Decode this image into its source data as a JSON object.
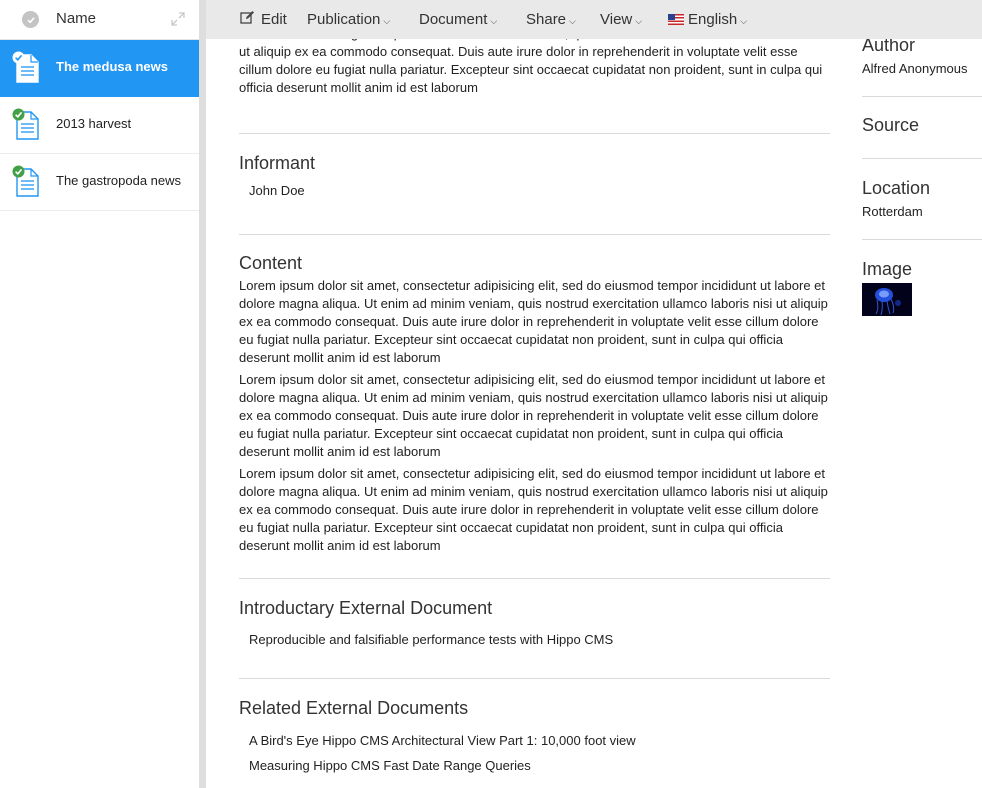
{
  "sidebar": {
    "header_label": "Name",
    "documents": [
      {
        "label": "The medusa news",
        "active": true
      },
      {
        "label": "2013 harvest",
        "active": false
      },
      {
        "label": "The gastropoda news",
        "active": false
      }
    ]
  },
  "toolbar": {
    "edit": "Edit",
    "publication": "Publication",
    "document": "Document",
    "share": "Share",
    "view": "View",
    "language": "English"
  },
  "main": {
    "intro_text": "labore et dolore magna aliqua. Ut enim ad minim veniam, quis nostrud exercitation ullamco laboris nisi ut aliquip ex ea commodo consequat. Duis aute irure dolor in reprehenderit in voluptate velit esse cillum dolore eu fugiat nulla pariatur. Excepteur sint occaecat cupidatat non proident, sunt in culpa qui officia deserunt mollit anim id est laborum",
    "informant": {
      "title": "Informant",
      "value": "John Doe"
    },
    "content": {
      "title": "Content",
      "paragraphs": [
        "Lorem ipsum dolor sit amet, consectetur adipisicing elit, sed do eiusmod tempor incididunt ut labore et dolore magna aliqua. Ut enim ad minim veniam, quis nostrud exercitation ullamco laboris nisi ut aliquip ex ea commodo consequat. Duis aute irure dolor in reprehenderit in voluptate velit esse cillum dolore eu fugiat nulla pariatur. Excepteur sint occaecat cupidatat non proident, sunt in culpa qui officia deserunt mollit anim id est laborum",
        "Lorem ipsum dolor sit amet, consectetur adipisicing elit, sed do eiusmod tempor incididunt ut labore et dolore magna aliqua. Ut enim ad minim veniam, quis nostrud exercitation ullamco laboris nisi ut aliquip ex ea commodo consequat. Duis aute irure dolor in reprehenderit in voluptate velit esse cillum dolore eu fugiat nulla pariatur. Excepteur sint occaecat cupidatat non proident, sunt in culpa qui officia deserunt mollit anim id est laborum",
        "Lorem ipsum dolor sit amet, consectetur adipisicing elit, sed do eiusmod tempor incididunt ut labore et dolore magna aliqua. Ut enim ad minim veniam, quis nostrud exercitation ullamco laboris nisi ut aliquip ex ea commodo consequat. Duis aute irure dolor in reprehenderit in voluptate velit esse cillum dolore eu fugiat nulla pariatur. Excepteur sint occaecat cupidatat non proident, sunt in culpa qui officia deserunt mollit anim id est laborum"
      ]
    },
    "intro_external": {
      "title": "Introductary External Document",
      "value": "Reproducible and falsifiable performance tests with Hippo CMS"
    },
    "related_external": {
      "title": "Related External Documents",
      "items": [
        "A Bird's Eye Hippo CMS Architectural View Part 1: 10,000 foot view",
        "Measuring Hippo CMS Fast Date Range Queries"
      ]
    }
  },
  "meta": {
    "author": {
      "title": "Author",
      "value": "Alfred Anonymous"
    },
    "source": {
      "title": "Source"
    },
    "location": {
      "title": "Location",
      "value": "Rotterdam"
    },
    "image": {
      "title": "Image"
    }
  },
  "colors": {
    "accent": "#2196f3",
    "published_check": "#43a047",
    "toolbar_bg": "#e9e9e9"
  },
  "icons": {
    "document": "document-icon",
    "published": "check-icon",
    "edit": "pencil-icon",
    "expand": "expand-icon",
    "language_flag": "us-flag-icon"
  }
}
